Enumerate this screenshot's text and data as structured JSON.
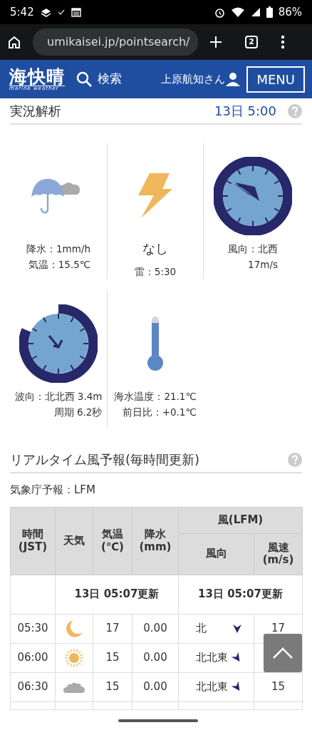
{
  "status_bar": {
    "time": "5:42",
    "battery": "86%"
  },
  "browser": {
    "url": "umikaisei.jp/pointsearch/",
    "tab_count": "2"
  },
  "header": {
    "logo": "海快晴",
    "logo_sub": "marine weather",
    "search": "検索",
    "user": "上原航知さん",
    "menu": "MENU"
  },
  "analysis": {
    "title": "実況解析",
    "time": "13日 5:00",
    "cells": [
      {
        "kind": "rain",
        "lines": [
          "降水：1mm/h",
          "気温：15.5℃"
        ]
      },
      {
        "kind": "thunder",
        "headline": "なし",
        "lines": [
          "雷：5:30"
        ]
      },
      {
        "kind": "wind",
        "lines": [
          "風向：北西",
          "17m/s"
        ]
      },
      {
        "kind": "wave",
        "lines": [
          "波向：北北西 3.4m",
          "周期 6.2秒"
        ]
      },
      {
        "kind": "sea",
        "level": 0.85,
        "lines": [
          "海水温度：21.1℃",
          "前日比：+0.1℃"
        ]
      }
    ]
  },
  "forecast": {
    "title": "リアルタイム風予報(毎時間更新)",
    "source": "気象庁予報：LFM",
    "table": {
      "group_header": "風(LFM)",
      "columns": [
        "時間\n(JST)",
        "天気",
        "気温\n(℃)",
        "降水\n(mm)",
        "風向",
        "風速\n(m/s)"
      ],
      "updates": [
        "13日 05:07更新",
        "13日 05:07更新"
      ],
      "rows": [
        {
          "time": "05:30",
          "weather": {
            "kind": "moon"
          },
          "temp": "17",
          "precip": "0.00",
          "wind_dir": "北",
          "arrow": {
            "kind": "s"
          },
          "wind_speed": "17"
        },
        {
          "time": "06:00",
          "weather": {
            "kind": "sun"
          },
          "temp": "15",
          "precip": "0.00",
          "wind_dir": "北北東",
          "arrow": {
            "kind": "ssw"
          }
        },
        {
          "time": "06:30",
          "weather": {
            "kind": "cloud"
          },
          "temp": "15",
          "precip": "0.00",
          "wind_dir": "北北東",
          "arrow": {
            "kind": "ssw"
          },
          "wind_speed": "15"
        }
      ]
    }
  }
}
